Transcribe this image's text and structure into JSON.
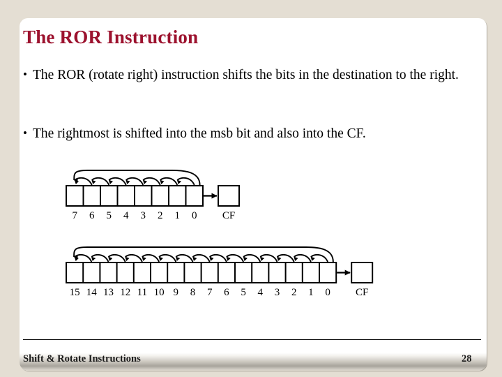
{
  "slide": {
    "title": "The ROR Instruction",
    "bullets": [
      {
        "marker": "•",
        "text": "The ROR (rotate right) instruction shifts the bits in the destination to the right."
      },
      {
        "marker": "•",
        "text": "The rightmost is shifted into the msb bit and also into the CF."
      }
    ],
    "footer": {
      "label": "Shift & Rotate Instructions",
      "page_number": "28"
    },
    "colors": {
      "title": "#9c122e",
      "page_background": "#e4ded3",
      "card_background": "#ffffff",
      "diagram_stroke": "#000000"
    }
  },
  "diagrams": [
    {
      "name": "ror-8-bit",
      "bit_labels": [
        "7",
        "6",
        "5",
        "4",
        "3",
        "2",
        "1",
        "0"
      ],
      "flag_label": "CF",
      "cell_count": 8,
      "rotation": "right",
      "wrap_arrow": true,
      "carry_arrow": true
    },
    {
      "name": "ror-16-bit",
      "bit_labels": [
        "15",
        "14",
        "13",
        "12",
        "11",
        "10",
        "9",
        "8",
        "7",
        "6",
        "5",
        "4",
        "3",
        "2",
        "1",
        "0"
      ],
      "flag_label": "CF",
      "cell_count": 16,
      "rotation": "right",
      "wrap_arrow": true,
      "carry_arrow": true
    }
  ]
}
